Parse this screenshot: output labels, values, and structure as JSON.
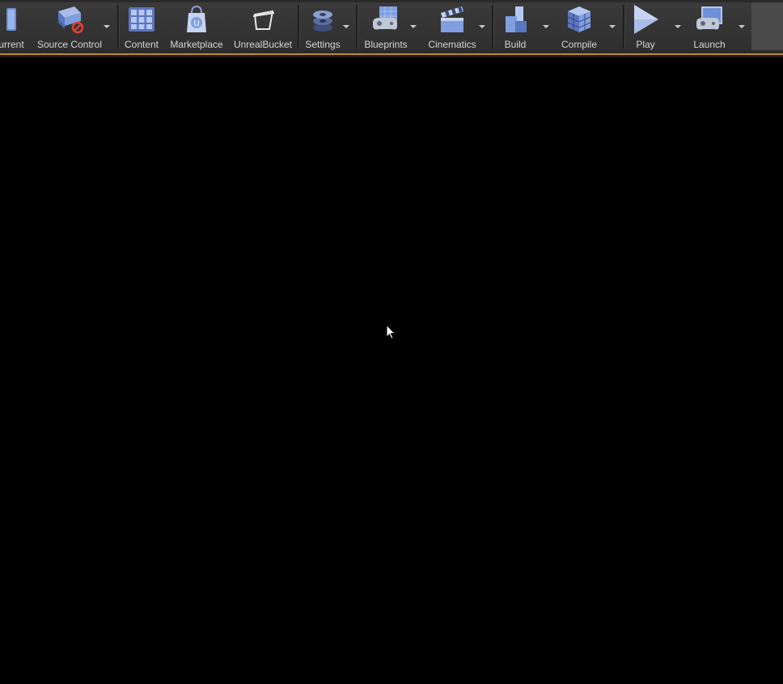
{
  "toolbar": {
    "items": [
      {
        "label": "urrent",
        "icon": "save-current-icon"
      },
      {
        "label": "Source Control",
        "icon": "source-control-icon"
      },
      {
        "label": "Content",
        "icon": "content-browser-icon"
      },
      {
        "label": "Marketplace",
        "icon": "marketplace-icon"
      },
      {
        "label": "UnrealBucket",
        "icon": "unrealbucket-icon"
      },
      {
        "label": "Settings",
        "icon": "settings-gears-icon"
      },
      {
        "label": "Blueprints",
        "icon": "blueprints-gamepad-icon"
      },
      {
        "label": "Cinematics",
        "icon": "cinematics-clapper-icon"
      },
      {
        "label": "Build",
        "icon": "build-blocks-icon"
      },
      {
        "label": "Compile",
        "icon": "compile-cubes-icon"
      },
      {
        "label": "Play",
        "icon": "play-icon"
      },
      {
        "label": "Launch",
        "icon": "launch-icon"
      }
    ]
  },
  "colors": {
    "toolbar_bg": "#3a3a3a",
    "accent": "#c08a2a",
    "viewport_bg": "#000000",
    "label": "#d4d4d4",
    "icon_blue": "#7f9fe0"
  }
}
